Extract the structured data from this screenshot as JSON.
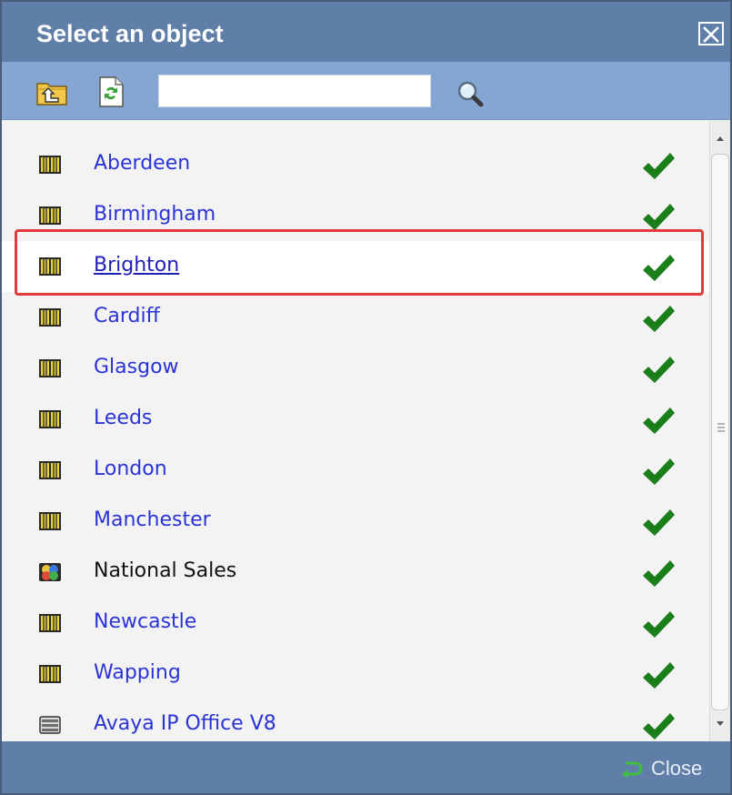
{
  "dialog": {
    "title": "Select an object",
    "close_icon": "close-x-icon"
  },
  "toolbar": {
    "up_icon": "folder-up-icon",
    "refresh_icon": "refresh-icon",
    "search_value": "",
    "search_icon": "magnifier-icon"
  },
  "list": {
    "items": [
      {
        "label": "Aberdeen",
        "icon": "site-icon",
        "status_icon": "check-icon",
        "selected": false
      },
      {
        "label": "Birmingham",
        "icon": "site-icon",
        "status_icon": "check-icon",
        "selected": false
      },
      {
        "label": "Brighton",
        "icon": "site-icon",
        "status_icon": "check-icon",
        "selected": true
      },
      {
        "label": "Cardiff",
        "icon": "site-icon",
        "status_icon": "check-icon",
        "selected": false
      },
      {
        "label": "Glasgow",
        "icon": "site-icon",
        "status_icon": "check-icon",
        "selected": false
      },
      {
        "label": "Leeds",
        "icon": "site-icon",
        "status_icon": "check-icon",
        "selected": false
      },
      {
        "label": "London",
        "icon": "site-icon",
        "status_icon": "check-icon",
        "selected": false
      },
      {
        "label": "Manchester",
        "icon": "site-icon",
        "status_icon": "check-icon",
        "selected": false
      },
      {
        "label": "National Sales",
        "icon": "group-icon",
        "status_icon": "check-icon",
        "selected": false
      },
      {
        "label": "Newcastle",
        "icon": "site-icon",
        "status_icon": "check-icon",
        "selected": false
      },
      {
        "label": "Wapping",
        "icon": "site-icon",
        "status_icon": "check-icon",
        "selected": false
      },
      {
        "label": "Avaya IP Office V8",
        "icon": "pbx-device-icon",
        "status_icon": "check-icon",
        "selected": false
      }
    ]
  },
  "footer": {
    "close_label": "Close",
    "close_icon": "return-arrow-icon"
  },
  "colors": {
    "header": "#5f7ea8",
    "toolbar": "#85a6d3",
    "link": "#2b33d6",
    "check": "#1a7f1a",
    "highlight": "#e33a3a"
  }
}
